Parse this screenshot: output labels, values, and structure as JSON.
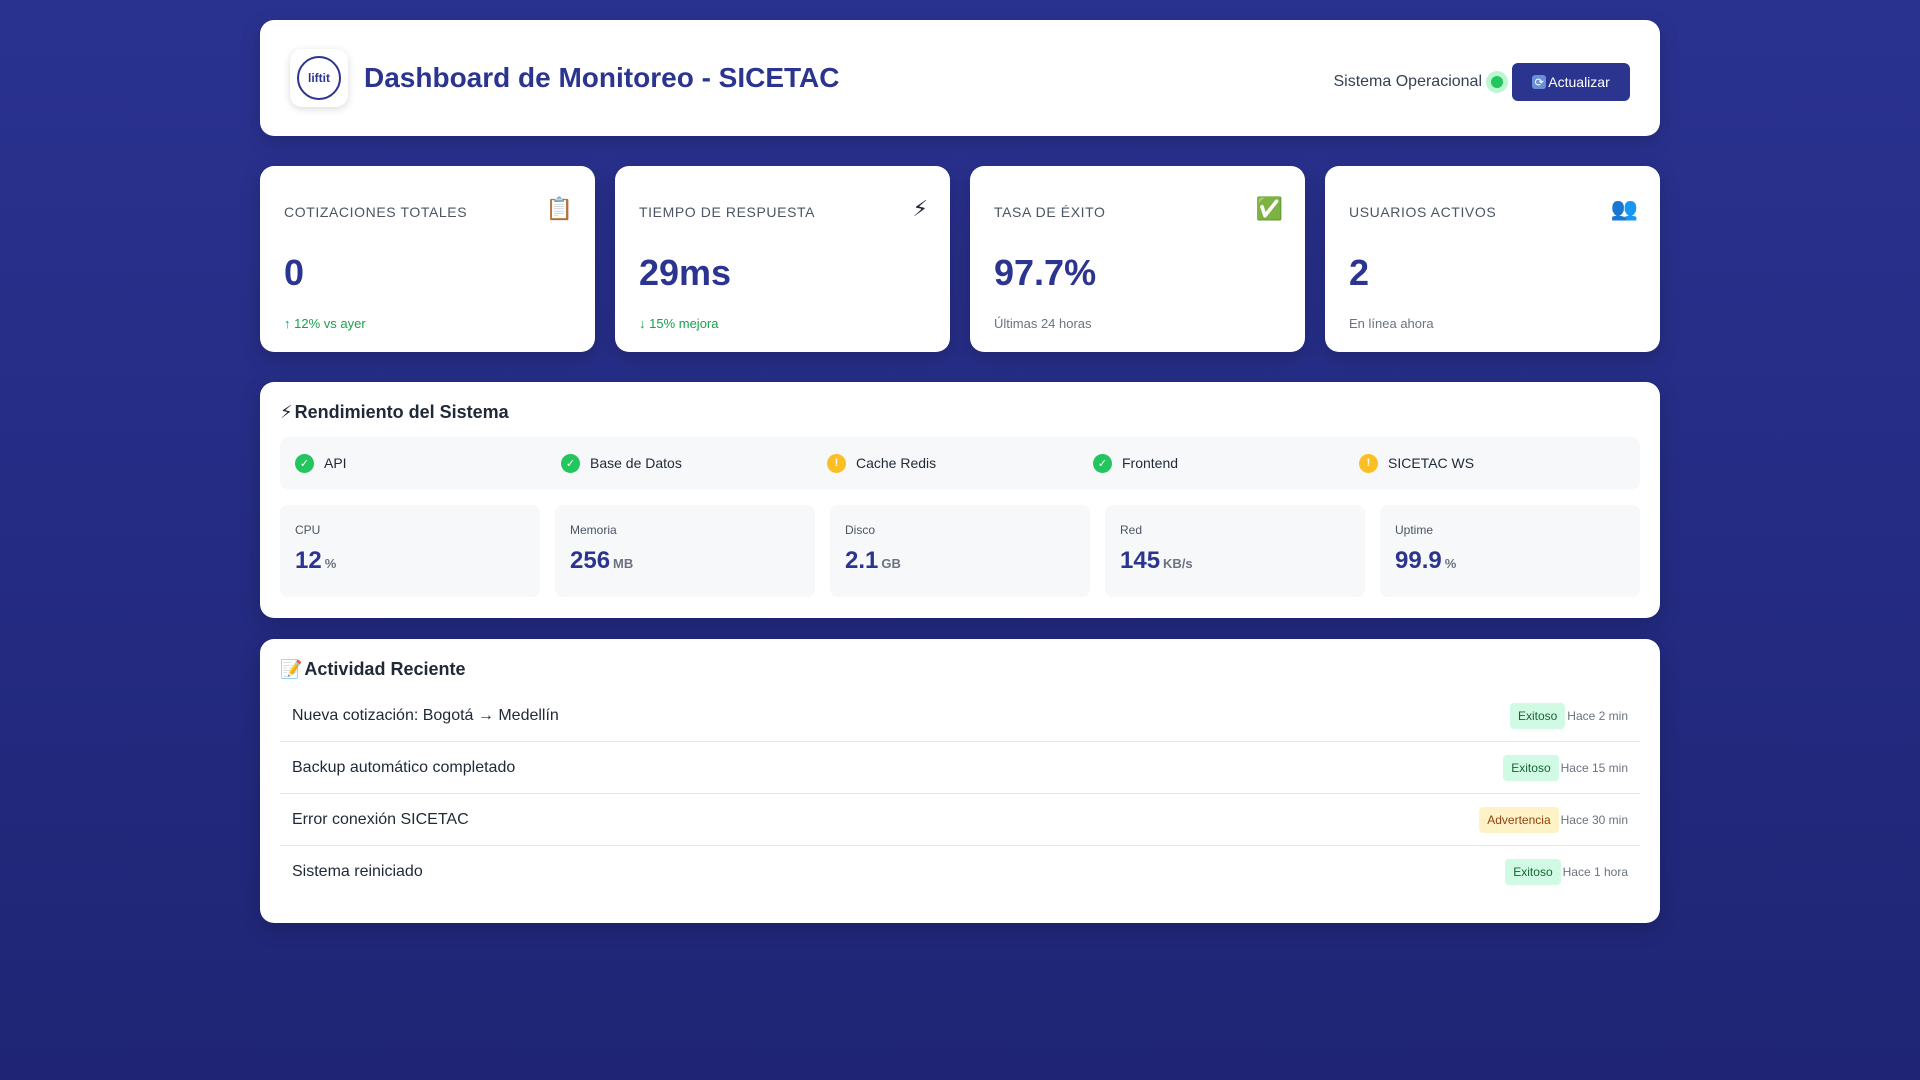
{
  "header": {
    "logo_text": "liftit",
    "title": "Dashboard de Monitoreo - SICETAC",
    "status_text": "Sistema Operacional",
    "refresh_label": "Actualizar"
  },
  "metrics": [
    {
      "label": "COTIZACIONES TOTALES",
      "icon": "clipboard-icon",
      "icon_glyph": "📋",
      "value": "0",
      "sub": "↑ 12% vs ayer",
      "sub_color": "#16a34a"
    },
    {
      "label": "TIEMPO DE RESPUESTA",
      "icon": "lightning-icon",
      "icon_glyph": "⚡",
      "value": "29ms",
      "sub": "↓ 15% mejora",
      "sub_color": "#16a34a"
    },
    {
      "label": "TASA DE ÉXITO",
      "icon": "check-box-icon",
      "icon_glyph": "✅",
      "value": "97.7%",
      "sub": "Últimas 24 horas",
      "sub_color": "#6b7280"
    },
    {
      "label": "USUARIOS ACTIVOS",
      "icon": "users-icon",
      "icon_glyph": "👥",
      "value": "2",
      "sub": "En línea ahora",
      "sub_color": "#6b7280"
    }
  ],
  "performance": {
    "title_icon": "⚡",
    "title": "Rendimiento del Sistema",
    "services": [
      {
        "name": "API",
        "status": "ok"
      },
      {
        "name": "Base de Datos",
        "status": "ok"
      },
      {
        "name": "Cache Redis",
        "status": "warn"
      },
      {
        "name": "Frontend",
        "status": "ok"
      },
      {
        "name": "SICETAC WS",
        "status": "warn"
      }
    ],
    "resources": [
      {
        "label": "CPU",
        "value": "12",
        "unit": "%"
      },
      {
        "label": "Memoria",
        "value": "256",
        "unit": "MB"
      },
      {
        "label": "Disco",
        "value": "2.1",
        "unit": "GB"
      },
      {
        "label": "Red",
        "value": "145",
        "unit": "KB/s"
      },
      {
        "label": "Uptime",
        "value": "99.9",
        "unit": "%"
      }
    ]
  },
  "activity": {
    "title_icon": "📝",
    "title": "Actividad Reciente",
    "items": [
      {
        "text": "Nueva cotización: Bogotá → Medellín",
        "badge": "Exitoso",
        "badge_type": "success",
        "time": "Hace 2 min"
      },
      {
        "text": "Backup automático completado",
        "badge": "Exitoso",
        "badge_type": "success",
        "time": "Hace 15 min"
      },
      {
        "text": "Error conexión SICETAC",
        "badge": "Advertencia",
        "badge_type": "warning",
        "time": "Hace 30 min"
      },
      {
        "text": "Sistema reiniciado",
        "badge": "Exitoso",
        "badge_type": "success",
        "time": "Hace 1 hora"
      }
    ]
  },
  "colors": {
    "primary": "#2b3590",
    "success": "#22c55e",
    "warning": "#fbbf24",
    "background": "#2a3290"
  }
}
